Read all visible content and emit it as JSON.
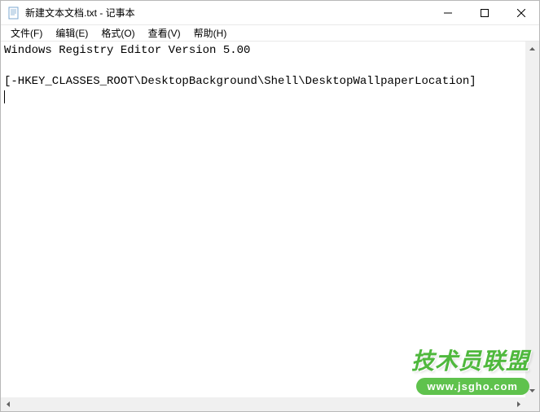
{
  "titlebar": {
    "title": "新建文本文档.txt - 记事本"
  },
  "menubar": {
    "file": "文件(F)",
    "edit": "编辑(E)",
    "format": "格式(O)",
    "view": "查看(V)",
    "help": "帮助(H)"
  },
  "editor": {
    "line1": "Windows Registry Editor Version 5.00",
    "line2": "",
    "line3": "[-HKEY_CLASSES_ROOT\\DesktopBackground\\Shell\\DesktopWallpaperLocation]"
  },
  "watermark": {
    "main": "技术员联盟",
    "sub": "www.jsgho.com"
  }
}
